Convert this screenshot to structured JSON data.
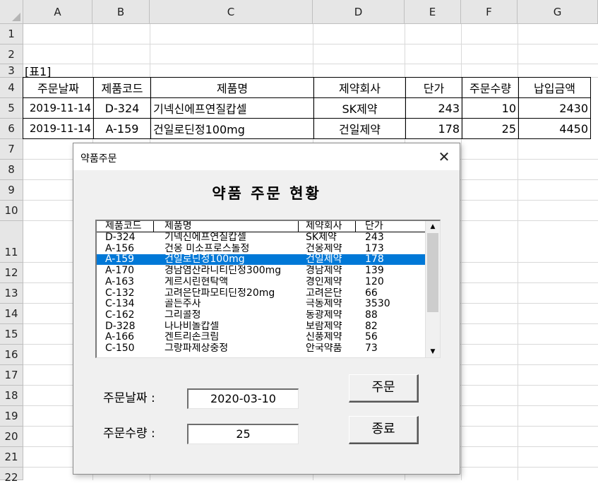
{
  "columns": [
    "A",
    "B",
    "C",
    "D",
    "E",
    "F",
    "G"
  ],
  "rows": [
    "1",
    "2",
    "3",
    "4",
    "5",
    "6",
    "7",
    "8",
    "9",
    "10",
    "11",
    "12",
    "13",
    "14",
    "15",
    "16",
    "17",
    "18",
    "19",
    "20",
    "21",
    "22"
  ],
  "table_caption": "[표1]",
  "table": {
    "headers": [
      "주문날짜",
      "제품코드",
      "제품명",
      "제약회사",
      "단가",
      "주문수량",
      "납입금액"
    ],
    "rows": [
      [
        "2019-11-14",
        "D-324",
        "기넥신에프연질캅셀",
        "SK제약",
        "243",
        "10",
        "2430"
      ],
      [
        "2019-11-14",
        "A-159",
        "건일로딘정100mg",
        "건일제약",
        "178",
        "25",
        "4450"
      ]
    ]
  },
  "dialog": {
    "title": "약품주문",
    "close_glyph": "✕",
    "heading": "약품 주문 현황",
    "list": {
      "headers": [
        "제품코드",
        "제품명",
        "제약회사",
        "단가"
      ],
      "selected_index": 2,
      "items": [
        [
          "D-324",
          "기넥신에프연질캅셀",
          "SK제약",
          "243"
        ],
        [
          "A-156",
          "건옹 미소프로스톨정",
          "건옹제약",
          "173"
        ],
        [
          "A-159",
          "건일로딘정100mg",
          "건일제약",
          "178"
        ],
        [
          "A-170",
          "경남염산라니티딘정300mg",
          "경남제약",
          "139"
        ],
        [
          "A-163",
          "게르시린현탁액",
          "경인제약",
          "120"
        ],
        [
          "C-132",
          "고려은단파모티딘정20mg",
          "고려은단",
          "66"
        ],
        [
          "C-134",
          "골든주사",
          "극동제약",
          "3530"
        ],
        [
          "C-162",
          "그리콜정",
          "동광제약",
          "88"
        ],
        [
          "D-328",
          "나나비놀캅셀",
          "보람제약",
          "82"
        ],
        [
          "A-166",
          "겐트리손크림",
          "신풍제약",
          "56"
        ],
        [
          "C-150",
          "그랑파제상중정",
          "안국약품",
          "73"
        ]
      ]
    },
    "order_date_label": "주문날짜 :",
    "order_date_value": "2020-03-10",
    "order_qty_label": "주문수량 :",
    "order_qty_value": "25",
    "order_button": "주문",
    "close_button": "종료"
  }
}
